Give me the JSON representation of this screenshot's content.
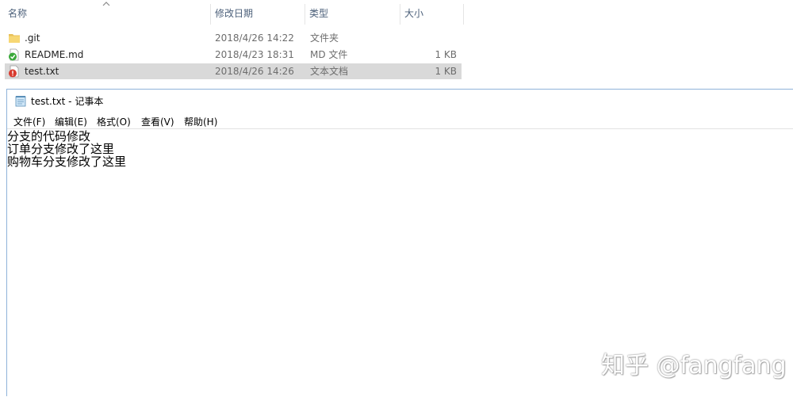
{
  "explorer": {
    "columns": {
      "name": "名称",
      "modified": "修改日期",
      "type": "类型",
      "size": "大小"
    },
    "files": [
      {
        "name": ".git",
        "modified": "2018/4/26 14:22",
        "type": "文件夹",
        "size": "",
        "icon": "folder-icon",
        "selected": false
      },
      {
        "name": "README.md",
        "modified": "2018/4/23 18:31",
        "type": "MD 文件",
        "size": "1 KB",
        "icon": "git-clean-file-icon",
        "selected": false
      },
      {
        "name": "test.txt",
        "modified": "2018/4/26 14:26",
        "type": "文本文档",
        "size": "1 KB",
        "icon": "git-conflict-file-icon",
        "selected": true
      }
    ]
  },
  "notepad": {
    "title": "test.txt - 记事本",
    "menu": [
      "文件(F)",
      "编辑(E)",
      "格式(O)",
      "查看(V)",
      "帮助(H)"
    ],
    "lines": [
      "分支的代码修改",
      "订单分支修改了这里",
      "购物车分支修改了这里"
    ]
  },
  "watermark": "知乎 @fangfang",
  "colors": {
    "header_text": "#4c607a",
    "selected_row": "#d9d9d9",
    "window_border": "#8fb3d9"
  }
}
